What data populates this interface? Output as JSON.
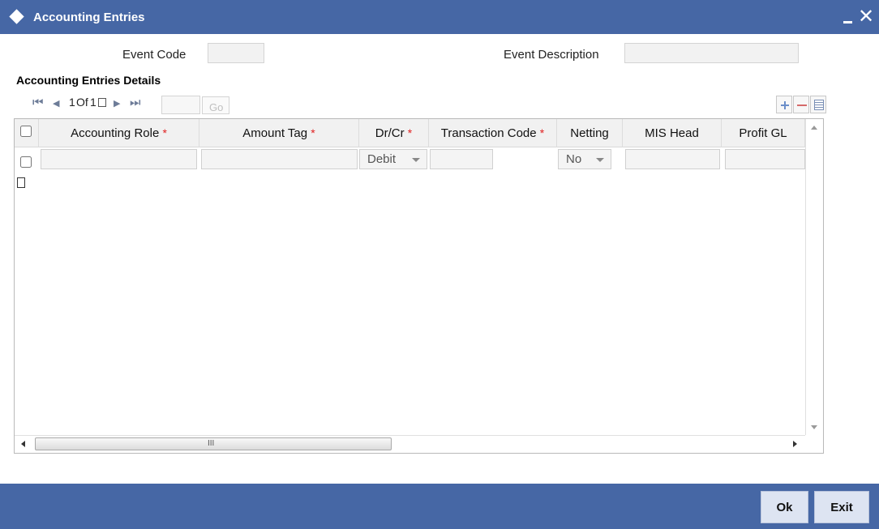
{
  "window": {
    "title": "Accounting Entries",
    "minimize_label": "_",
    "close_label": "✕"
  },
  "form": {
    "event_code_label": "Event Code",
    "event_code_value": "",
    "event_description_label": "Event Description",
    "event_description_value": ""
  },
  "section": {
    "title": "Accounting Entries Details"
  },
  "pager": {
    "first_icon": "first-page-icon",
    "prev_icon": "prev-page-icon",
    "page_current": "1",
    "page_of": "Of",
    "page_total": "1",
    "next_icon": "next-page-icon",
    "last_icon": "last-page-icon",
    "go_label": "Go",
    "page_input_value": ""
  },
  "toolbar": {
    "add_icon": "plus-icon",
    "delete_icon": "minus-icon",
    "columns_icon": "columns-icon"
  },
  "grid": {
    "columns": [
      {
        "label": "Accounting Role",
        "required": true
      },
      {
        "label": "Amount Tag",
        "required": true
      },
      {
        "label": "Dr/Cr",
        "required": true
      },
      {
        "label": "Transaction Code",
        "required": true
      },
      {
        "label": "Netting",
        "required": false
      },
      {
        "label": "MIS Head",
        "required": false
      },
      {
        "label": "Profit GL",
        "required": false
      }
    ],
    "required_marker": "*",
    "rows": [
      {
        "accounting_role": "",
        "amount_tag": "",
        "dr_cr": "Debit",
        "transaction_code": "",
        "netting": "No",
        "mis_head": "",
        "profit_gl": ""
      }
    ],
    "hscroll_grip": "III"
  },
  "footer": {
    "ok_label": "Ok",
    "exit_label": "Exit"
  },
  "colors": {
    "titlebar": "#4667a5",
    "footer": "#4667a5",
    "required": "#e02020",
    "button_bg": "#dde4f2"
  }
}
